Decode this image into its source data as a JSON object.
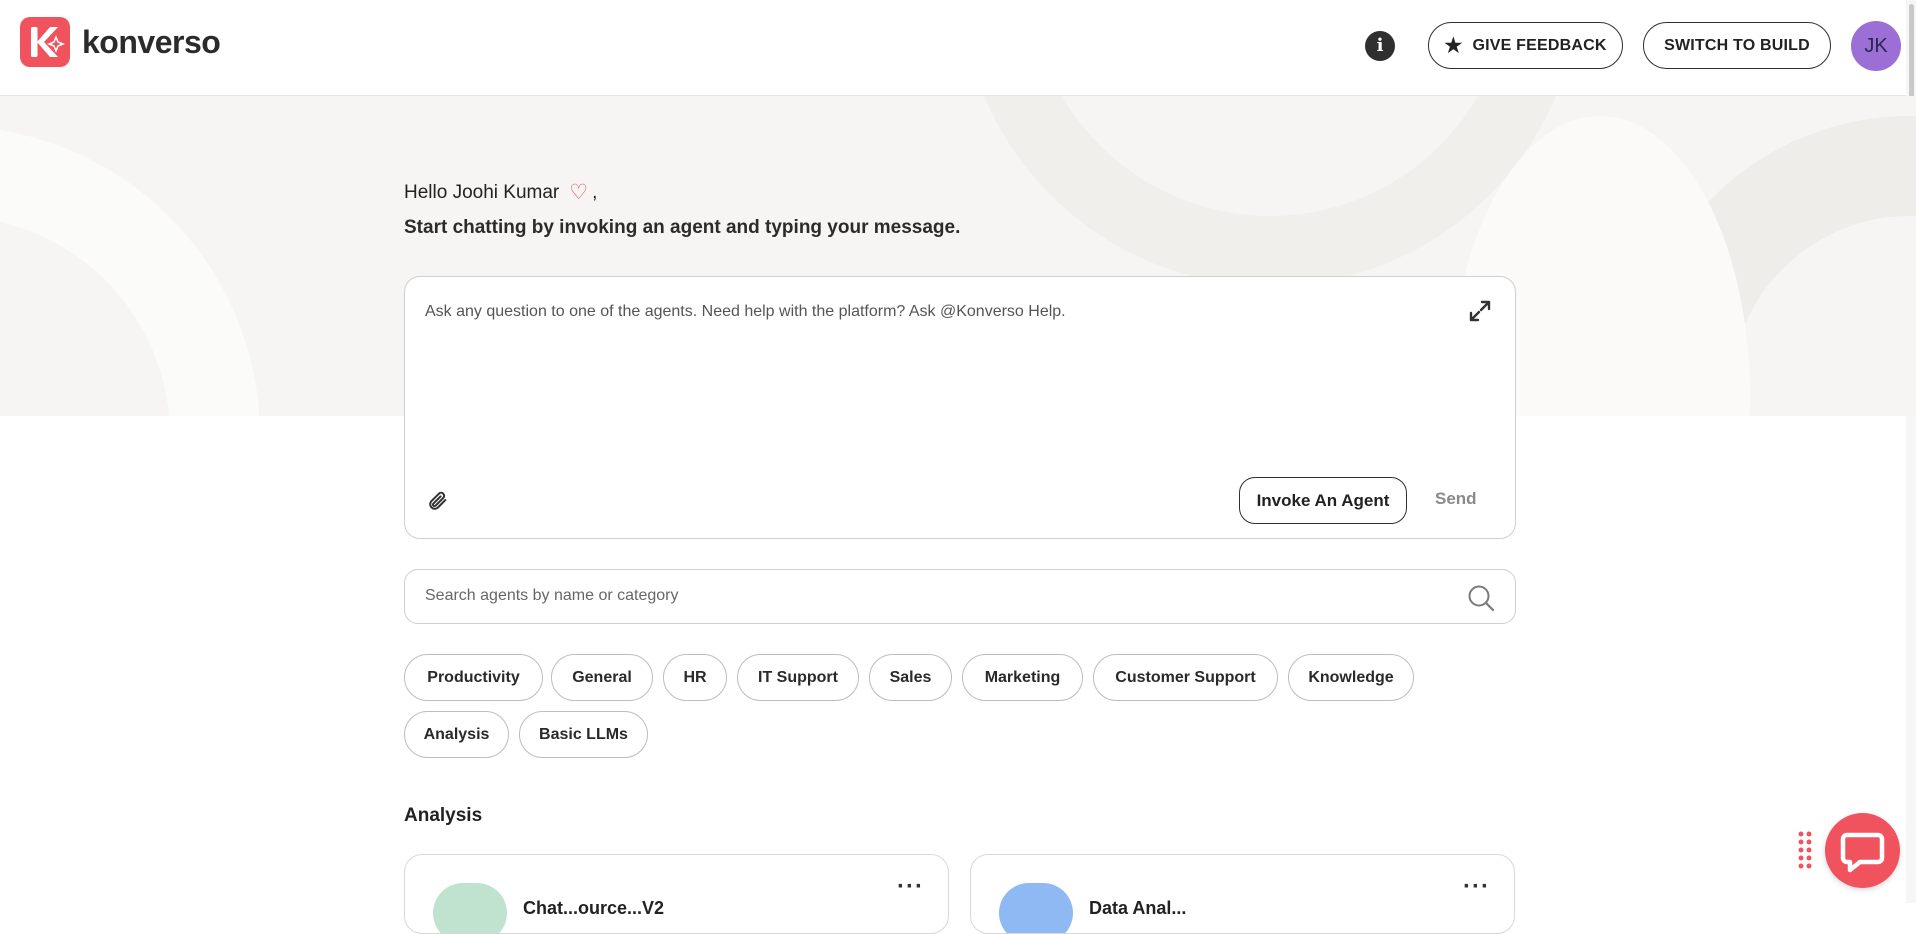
{
  "header": {
    "logo_text": "konverso",
    "info_icon": "info-icon",
    "feedback_label": "GIVE FEEDBACK",
    "build_label": "SWITCH TO BUILD",
    "avatar_initials": "JK"
  },
  "greeting": {
    "hello": "Hello Joohi Kumar",
    "comma": ",",
    "subtitle": "Start chatting by invoking an agent and typing your message."
  },
  "chat": {
    "placeholder": "Ask any question to one of the agents. Need help with the platform? Ask @Konverso Help.",
    "invoke_label": "Invoke An Agent",
    "send_label": "Send"
  },
  "search": {
    "placeholder": "Search agents by name or category"
  },
  "categories": [
    "Productivity",
    "General",
    "HR",
    "IT Support",
    "Sales",
    "Marketing",
    "Customer Support",
    "Knowledge",
    "Analysis",
    "Basic LLMs"
  ],
  "section": {
    "title": "Analysis"
  },
  "cards": [
    {
      "title": "Chat...ource...V2",
      "avatar_color": "#bfe3cf"
    },
    {
      "title": "Data Anal...",
      "avatar_color": "#8fb9f2"
    }
  ],
  "colors": {
    "brand": "#f0525e",
    "avatar": "#9b6fd6",
    "hero_bg": "#f6f5f3"
  }
}
